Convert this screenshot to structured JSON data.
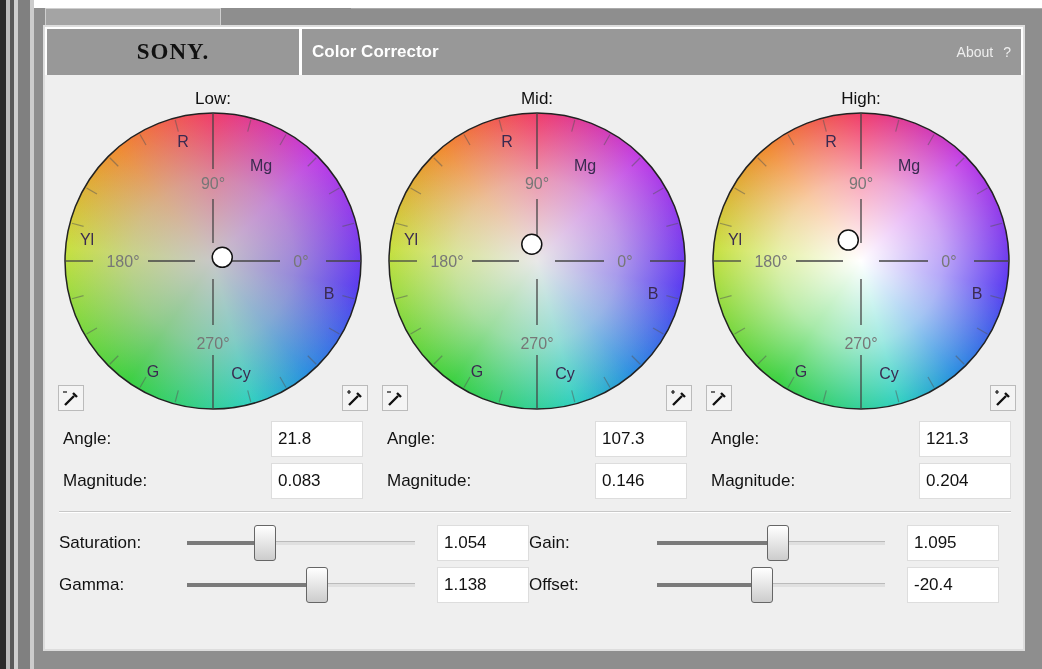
{
  "header": {
    "logo": "SONY.",
    "title": "Color Corrector",
    "about": "About",
    "help": "?"
  },
  "wheels": [
    {
      "label": "Low:",
      "hue_labels": [
        "R",
        "Mg",
        "Yl",
        "B",
        "G",
        "Cy"
      ],
      "degree_labels": [
        "90°",
        "0°",
        "270°",
        "180°"
      ],
      "angle_label": "Angle:",
      "angle": "21.8",
      "magnitude_label": "Magnitude:",
      "magnitude": "0.083"
    },
    {
      "label": "Mid:",
      "hue_labels": [
        "R",
        "Mg",
        "Yl",
        "B",
        "G",
        "Cy"
      ],
      "degree_labels": [
        "90°",
        "0°",
        "270°",
        "180°"
      ],
      "angle_label": "Angle:",
      "angle": "107.3",
      "magnitude_label": "Magnitude:",
      "magnitude": "0.146"
    },
    {
      "label": "High:",
      "hue_labels": [
        "R",
        "Mg",
        "Yl",
        "B",
        "G",
        "Cy"
      ],
      "degree_labels": [
        "90°",
        "0°",
        "270°",
        "180°"
      ],
      "angle_label": "Angle:",
      "angle": "121.3",
      "magnitude_label": "Magnitude:",
      "magnitude": "0.204"
    }
  ],
  "sliders": [
    {
      "label": "Saturation:",
      "level": 0.34,
      "value": "1.054"
    },
    {
      "label": "Gain:",
      "level": 0.53,
      "value": "1.095"
    },
    {
      "label": "Gamma:",
      "level": 0.57,
      "value": "1.138"
    },
    {
      "label": "Offset:",
      "level": 0.46,
      "value": "-20.4"
    }
  ]
}
